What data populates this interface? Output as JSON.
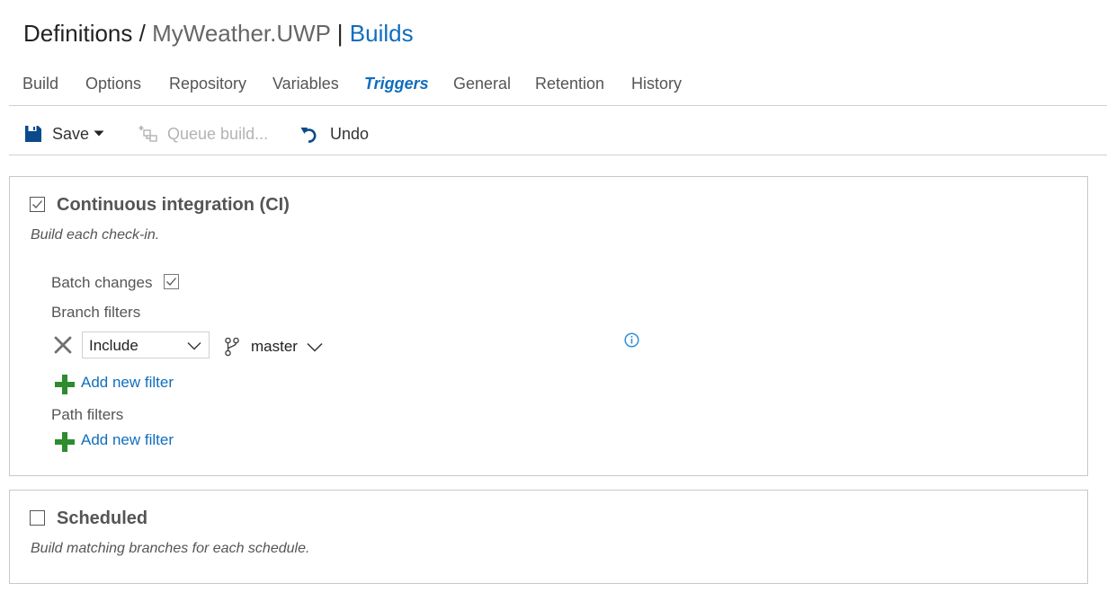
{
  "header": {
    "crumb_root": "Definitions",
    "crumb_sep": "/",
    "definition_name": "MyWeather.UWP",
    "pipe": "|",
    "builds_link": "Builds"
  },
  "tabs": [
    {
      "label": "Build"
    },
    {
      "label": "Options"
    },
    {
      "label": "Repository"
    },
    {
      "label": "Variables"
    },
    {
      "label": "Triggers",
      "active": true
    },
    {
      "label": "General"
    },
    {
      "label": "Retention"
    },
    {
      "label": "History"
    }
  ],
  "toolbar": {
    "save_label": "Save",
    "queue_label": "Queue build...",
    "undo_label": "Undo"
  },
  "ci": {
    "title": "Continuous integration (CI)",
    "checked": true,
    "description": "Build each check-in.",
    "batch_label": "Batch changes",
    "batch_checked": true,
    "branch_filters_label": "Branch filters",
    "filter_type": "Include",
    "branch": "master",
    "add_branch_filter": "Add new filter",
    "path_filters_label": "Path filters",
    "add_path_filter": "Add new filter"
  },
  "scheduled": {
    "title": "Scheduled",
    "checked": false,
    "description": "Build matching branches for each schedule."
  },
  "colors": {
    "accent": "#106ebe",
    "add_green": "#2e8b2e",
    "save_icon": "#0b4a8a"
  },
  "icons": {
    "save": "save-icon",
    "queue": "queue-build-icon",
    "undo": "undo-icon",
    "remove_filter": "close-icon",
    "branch": "git-branch-icon",
    "info": "info-icon",
    "add": "plus-icon"
  }
}
